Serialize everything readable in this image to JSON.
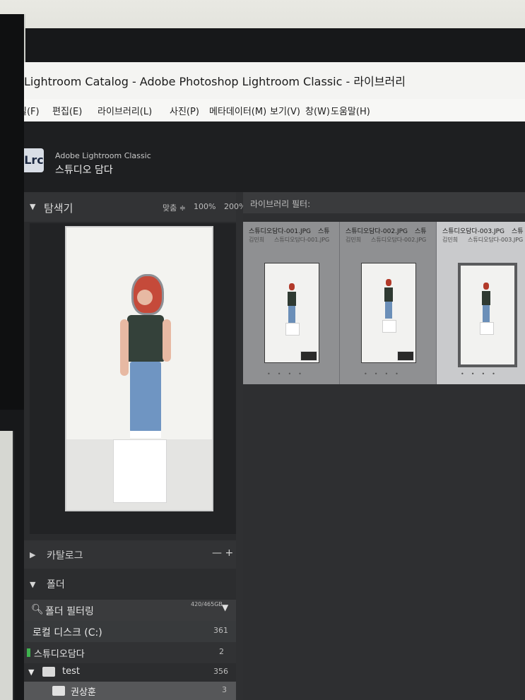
{
  "window": {
    "title": "Lightroom Catalog - Adobe Photoshop Lightroom Classic - 라이브러리"
  },
  "menu": {
    "items": [
      "일(F)",
      "편집(E)",
      "라이브러리(L)",
      "사진(P)",
      "메타데이터(M)",
      "보기(V)",
      "창(W)",
      "도움말(H)"
    ]
  },
  "identity": {
    "logo": "Lrc",
    "app_name": "Adobe Lightroom Classic",
    "catalog_name": "스튜디오 담다"
  },
  "navigator": {
    "title": "탐색기",
    "zoom_fit": "맞춤 ≑",
    "zoom_100": "100%",
    "zoom_200": "200% ≑"
  },
  "panels": {
    "catalog_title": "카탈로그",
    "catalog_actions": "— +",
    "folders_title": "폴더",
    "folder_filter_label": "폴더 필터링",
    "disk_usage": "420/465GB",
    "drive_label": "로컬 디스크 (C:)",
    "drive_count": "361",
    "studio_folder": "스튜디오담다",
    "studio_count": "2",
    "test_folder": "test",
    "test_count": "356",
    "kwon_folder": "권상훈",
    "kwon_count": "3"
  },
  "library_filter": {
    "label": "라이브러리 필터:"
  },
  "grid": {
    "cells": [
      {
        "name": "스튜디오담다-001.JPG",
        "extra": "스튜",
        "sub1": "김민희",
        "sub2": "스튜디오담다-001.JPG",
        "selected": false
      },
      {
        "name": "스튜디오담다-002.JPG",
        "extra": "스튜",
        "sub1": "김민희",
        "sub2": "스튜디오담다-002.JPG",
        "selected": false
      },
      {
        "name": "스튜디오담다-003.JPG",
        "extra": "스튜",
        "sub1": "김민희",
        "sub2": "스튜디오담다-003.JPG",
        "selected": true
      }
    ]
  },
  "icons": {
    "nav_toggle": "triangle-down-icon",
    "search": "search-icon",
    "folder": "folder-icon",
    "drive_light": "drive-status-icon"
  },
  "colors": {
    "panel_bg": "#2a2b2d",
    "grid_bg": "#2e2f31",
    "cell_bg": "#8f9092",
    "cell_selected": "#c9cacc",
    "drive_ok": "#3fb34f"
  }
}
